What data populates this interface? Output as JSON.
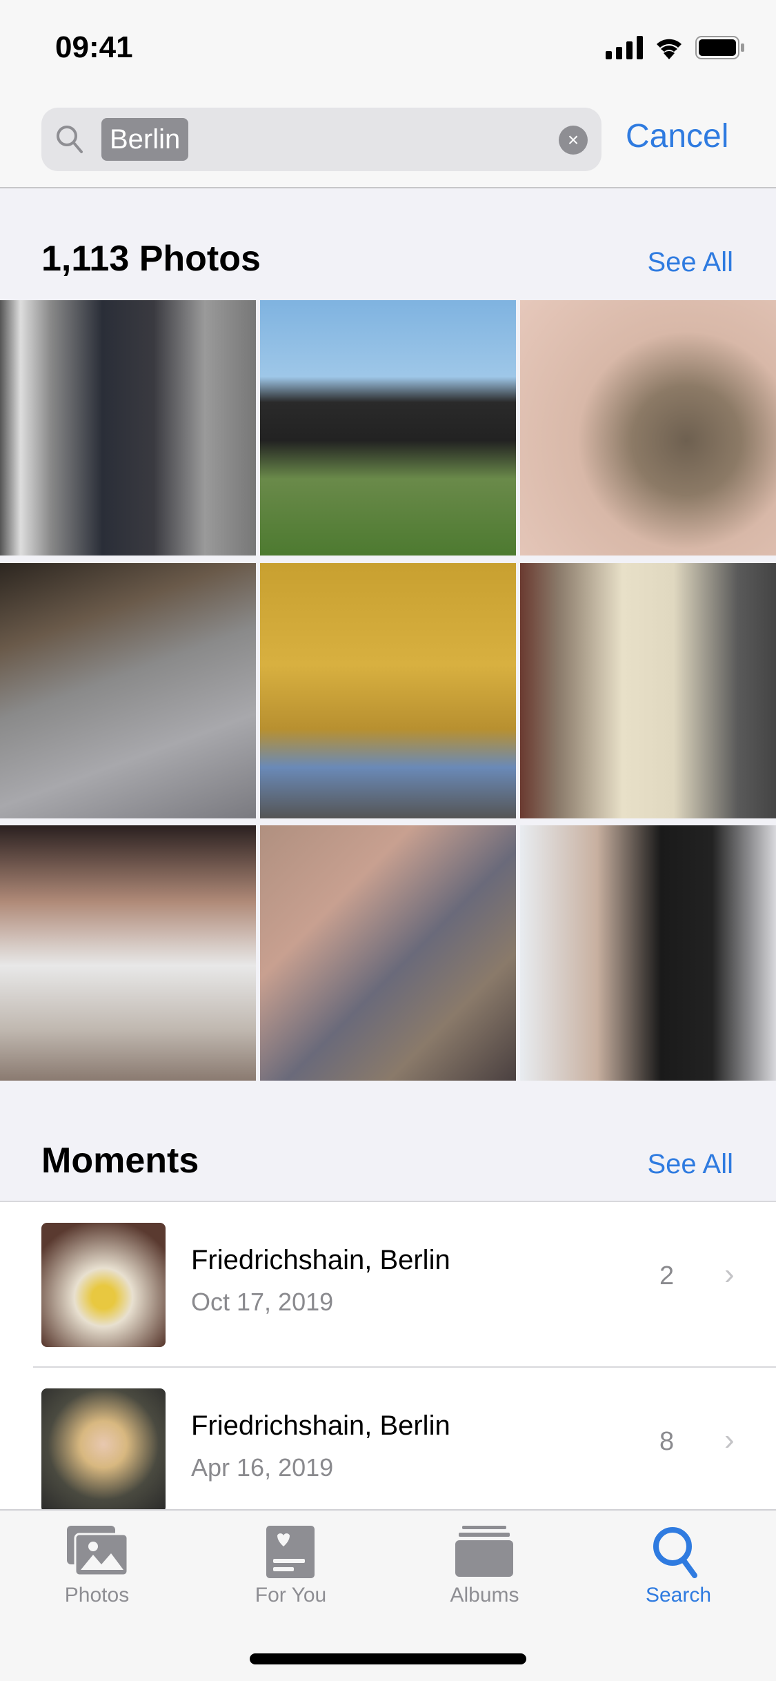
{
  "status_bar": {
    "time": "09:41",
    "icons": [
      "cellular-signal-icon",
      "wifi-icon",
      "battery-icon"
    ]
  },
  "search": {
    "token": "Berlin",
    "cancel_label": "Cancel"
  },
  "photos_section": {
    "title": "1,113 Photos",
    "see_all": "See All",
    "photos": [
      "mirror-selfie-hallway",
      "cat-on-balcony",
      "cat-closeup",
      "cat-sleeping-blanket",
      "autumn-tree",
      "mirror-selfie-tshirt",
      "selfie-nirvana-shirt",
      "selfie-with-cat",
      "mirror-selfie-black-shirt"
    ]
  },
  "moments_section": {
    "title": "Moments",
    "see_all": "See All",
    "items": [
      {
        "title": "Friedrichshain, Berlin",
        "date": "Oct 17, 2019",
        "count": "2"
      },
      {
        "title": "Friedrichshain, Berlin",
        "date": "Apr 16, 2019",
        "count": "8"
      }
    ]
  },
  "tabbar": {
    "accent": "#2f7be0",
    "tabs": [
      {
        "label": "Photos",
        "icon": "photos-icon"
      },
      {
        "label": "For You",
        "icon": "for-you-icon"
      },
      {
        "label": "Albums",
        "icon": "albums-icon"
      },
      {
        "label": "Search",
        "icon": "search-icon",
        "active": true
      }
    ]
  }
}
